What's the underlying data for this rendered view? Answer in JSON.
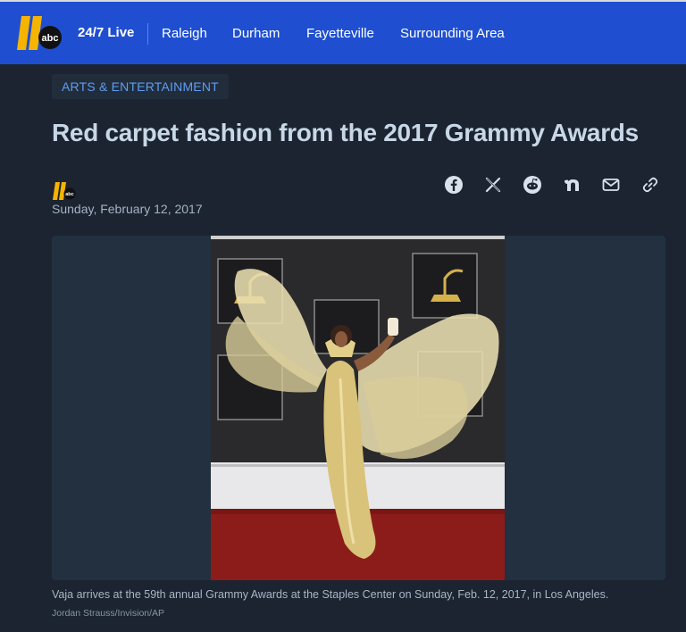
{
  "nav": {
    "live_label": "24/7 Live",
    "items": [
      "Raleigh",
      "Durham",
      "Fayetteville",
      "Surrounding Area"
    ],
    "logo": {
      "number": "11",
      "network": "abc"
    },
    "brand_color": "#1f4fd0"
  },
  "article": {
    "category": "ARTS & ENTERTAINMENT",
    "title": "Red carpet fashion from the 2017 Grammy Awards",
    "date": "Sunday, February 12, 2017",
    "byline_logo": {
      "number": "11",
      "network": "abc"
    }
  },
  "share": {
    "icons": [
      "facebook-icon",
      "x-icon",
      "reddit-icon",
      "nextdoor-icon",
      "email-icon",
      "link-icon"
    ]
  },
  "media": {
    "caption": "Vaja arrives at the 59th annual Grammy Awards at the Staples Center on Sunday, Feb. 12, 2017, in Los Angeles.",
    "credit": "Jordan Strauss/Invision/AP"
  },
  "colors": {
    "background": "#1b2430",
    "headline": "#c8d7e6",
    "category_text": "#5e9df3",
    "logo_gold": "#f5b400"
  }
}
